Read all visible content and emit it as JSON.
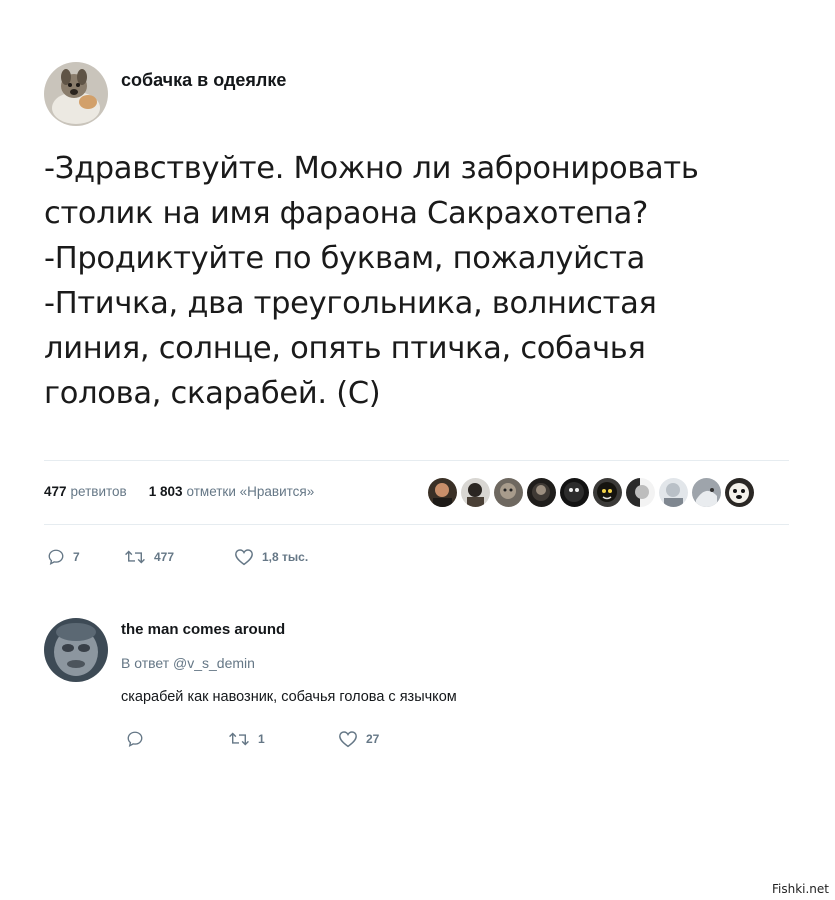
{
  "tweet": {
    "author_name": "собачка в одеялке",
    "body_lines": [
      "-Здравствуйте. Можно ли забронировать",
      "столик на имя фараона Сакрахотепа?",
      "-Продиктуйте по буквам, пожалуйста",
      "-Птичка, два треугольника, волнистая",
      "линия, солнце, опять птичка, собачья",
      "голова, скарабей. (С)"
    ],
    "retweets_count": "477",
    "retweets_label": "ретвитов",
    "likes_count": "1 803",
    "likes_label": "отметки «Нравится»",
    "actions": {
      "replies": "7",
      "retweets": "477",
      "likes": "1,8 тыс."
    }
  },
  "reply": {
    "author_name": "the man comes around",
    "reply_to": "В ответ @v_s_demin",
    "text": "скарабей как навозник, собачья голова с язычком",
    "actions": {
      "replies": "",
      "retweets": "1",
      "likes": "27"
    }
  },
  "watermark": "Fishki.net",
  "colors": {
    "text": "#14171a",
    "muted": "#657786",
    "divider": "#e6ecf0"
  }
}
